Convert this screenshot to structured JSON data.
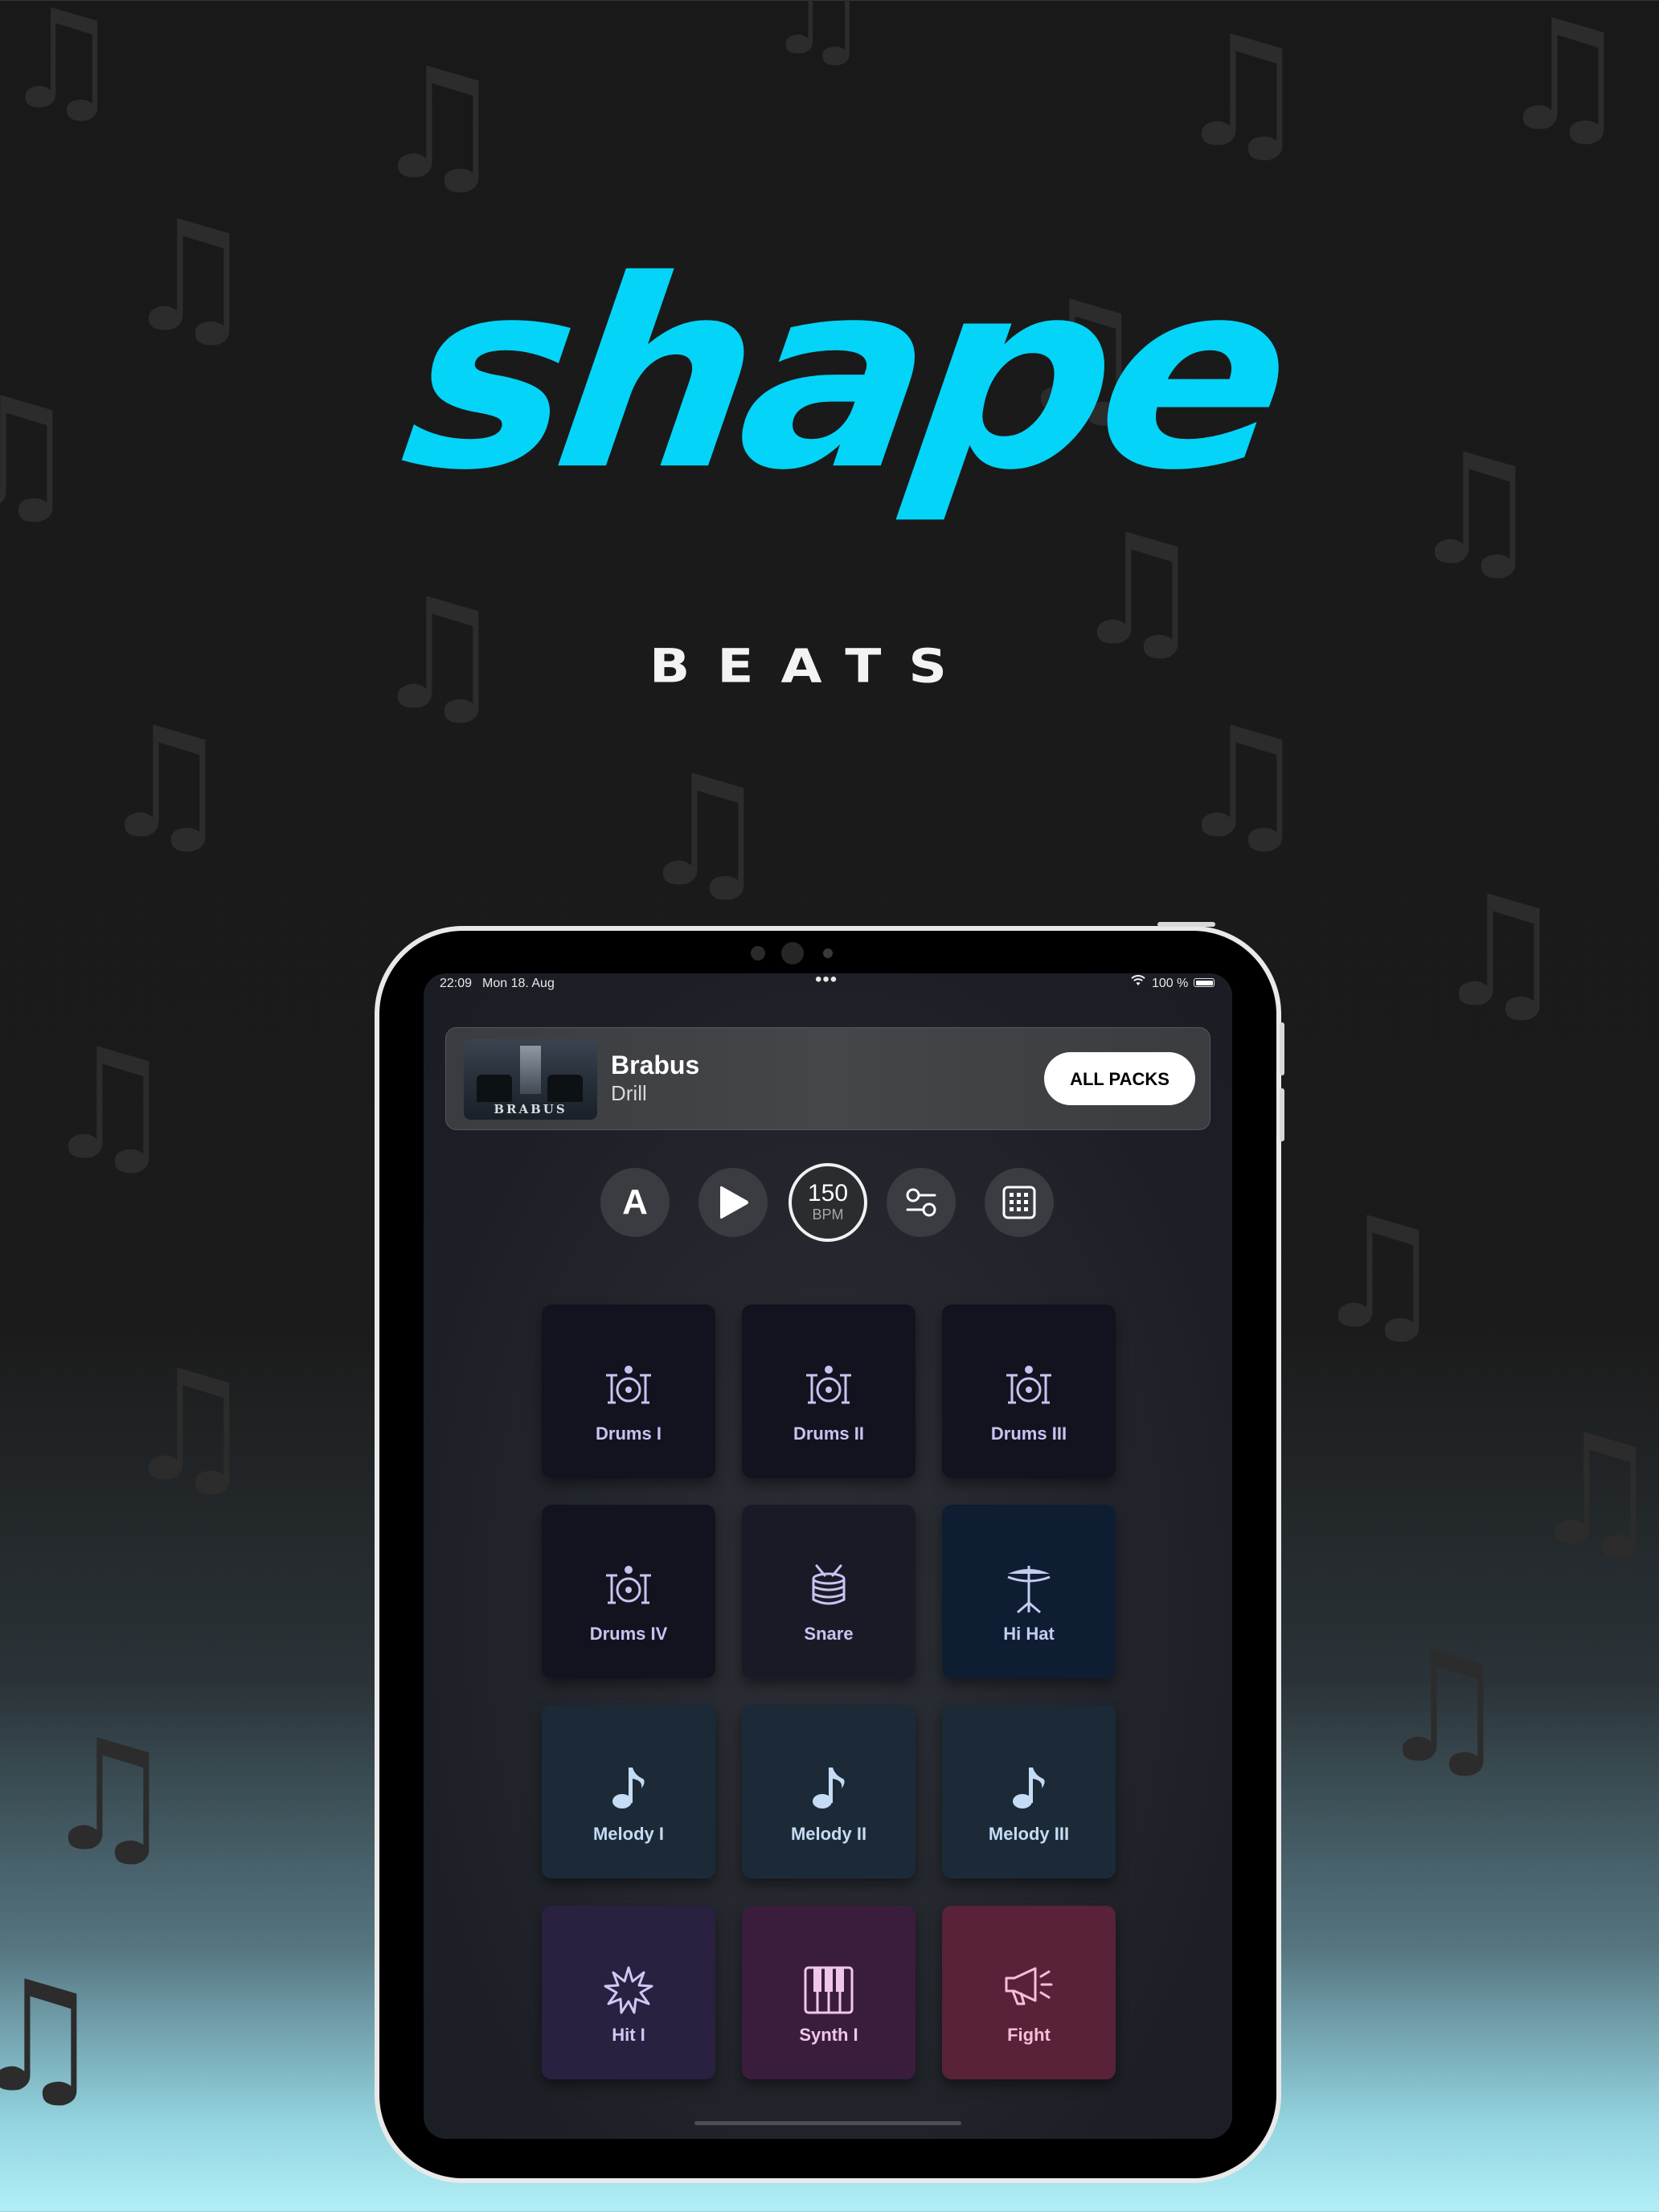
{
  "brand": {
    "logo_text": "shape",
    "subtitle": "BEATS",
    "accent": "#04d4f8"
  },
  "status_bar": {
    "time": "22:09",
    "date": "Mon 18. Aug",
    "battery": "100 %"
  },
  "pack": {
    "thumb_label": "BRABUS",
    "title": "Brabus",
    "genre": "Drill",
    "all_packs_label": "ALL PACKS"
  },
  "controls": {
    "mode_label": "A",
    "bpm_value": "150",
    "bpm_unit": "BPM"
  },
  "pads": [
    {
      "label": "Drums I",
      "icon": "drum-kit-icon",
      "color": "#13131f",
      "text": "#c9c3f2"
    },
    {
      "label": "Drums II",
      "icon": "drum-kit-icon",
      "color": "#13131f",
      "text": "#c9c3f2"
    },
    {
      "label": "Drums III",
      "icon": "drum-kit-icon",
      "color": "#13131f",
      "text": "#c9c3f2"
    },
    {
      "label": "Drums IV",
      "icon": "drum-kit-icon",
      "color": "#13131f",
      "text": "#c9c3f2"
    },
    {
      "label": "Snare",
      "icon": "snare-drum-icon",
      "color": "#181b26",
      "text": "#c9c3f2"
    },
    {
      "label": "Hi Hat",
      "icon": "hi-hat-icon",
      "color": "#0f1d33",
      "text": "#c2cdf0"
    },
    {
      "label": "Melody I",
      "icon": "music-note-icon",
      "color": "#1c2a38",
      "text": "#c4dcf4"
    },
    {
      "label": "Melody II",
      "icon": "music-note-icon",
      "color": "#1c2a38",
      "text": "#c4dcf4"
    },
    {
      "label": "Melody III",
      "icon": "music-note-icon",
      "color": "#1c2a38",
      "text": "#c4dcf4"
    },
    {
      "label": "Hit I",
      "icon": "burst-icon",
      "color": "#2a2040",
      "text": "#d2c7f4"
    },
    {
      "label": "Synth I",
      "icon": "piano-keys-icon",
      "color": "#3a1d3c",
      "text": "#f0c7ea"
    },
    {
      "label": "Fight",
      "icon": "megaphone-icon",
      "color": "#5a2238",
      "text": "#f7bfd7"
    }
  ]
}
